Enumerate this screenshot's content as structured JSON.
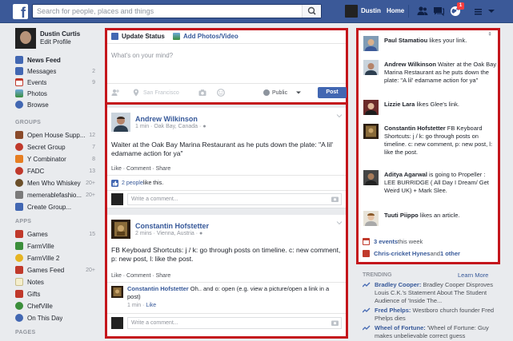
{
  "topbar": {
    "logo": "f",
    "search_placeholder": "Search for people, places and things",
    "user_name": "Dustin",
    "home_label": "Home",
    "notification_count": "1"
  },
  "leftnav": {
    "profile_name": "Dustin Curtis",
    "edit_profile": "Edit Profile",
    "favorites": [
      {
        "label": "News Feed",
        "icon": "news-feed-icon",
        "color": "#4267b2",
        "count": ""
      },
      {
        "label": "Messages",
        "icon": "messages-icon",
        "color": "#4267b2",
        "count": "2"
      },
      {
        "label": "Events",
        "icon": "events-icon",
        "color": "#c0392b",
        "count": "9"
      },
      {
        "label": "Photos",
        "icon": "photos-icon",
        "color": "#3b8e3b",
        "count": ""
      },
      {
        "label": "Browse",
        "icon": "browse-icon",
        "color": "#4267b2",
        "count": ""
      }
    ],
    "groups_heading": "GROUPS",
    "groups": [
      {
        "label": "Open House Supp...",
        "icon": "group-icon",
        "color": "#8a4a2a",
        "count": "12"
      },
      {
        "label": "Secret Group",
        "icon": "group-icon",
        "color": "#c0392b",
        "count": "7"
      },
      {
        "label": "Y Combinator",
        "icon": "group-icon",
        "color": "#e67e22",
        "count": "8"
      },
      {
        "label": "FADC",
        "icon": "group-icon",
        "color": "#c0392b",
        "count": "13"
      },
      {
        "label": "Men Who Whiskey",
        "icon": "group-icon",
        "color": "#6b4f2a",
        "count": "20+"
      },
      {
        "label": "memerablefashio...",
        "icon": "group-icon",
        "color": "#7a7a7a",
        "count": "20+"
      },
      {
        "label": "Create Group...",
        "icon": "create-group-icon",
        "color": "#4267b2",
        "count": ""
      }
    ],
    "apps_heading": "APPS",
    "apps": [
      {
        "label": "Games",
        "icon": "games-icon",
        "color": "#c0392b",
        "count": "15"
      },
      {
        "label": "FarmVille",
        "icon": "farmville-icon",
        "color": "#3b8e3b",
        "count": ""
      },
      {
        "label": "FarmVille 2",
        "icon": "farmville2-icon",
        "color": "#e6b422",
        "count": ""
      },
      {
        "label": "Games Feed",
        "icon": "games-feed-icon",
        "color": "#c0392b",
        "count": "20+"
      },
      {
        "label": "Notes",
        "icon": "notes-icon",
        "color": "#e0d7b0",
        "count": ""
      },
      {
        "label": "Gifts",
        "icon": "gifts-icon",
        "color": "#c0392b",
        "count": ""
      },
      {
        "label": "ChefVille",
        "icon": "chefville-icon",
        "color": "#3b8e3b",
        "count": ""
      },
      {
        "label": "On This Day",
        "icon": "on-this-day-icon",
        "color": "#4267b2",
        "count": ""
      }
    ],
    "pages_heading": "PAGES"
  },
  "composer": {
    "update_status": "Update Status",
    "add_photos": "Add Photos/Video",
    "placeholder": "What's on your mind?",
    "location": "San Francisco",
    "audience": "Public",
    "post_label": "Post"
  },
  "stories": [
    {
      "author": "Andrew Wilkinson",
      "meta": "1 min · Oak Bay, Canada ·",
      "text": "Waiter at the Oak Bay Marina Restaurant as he puts down the plate: \"A lil' edamame action for ya\"",
      "actions": "Like · Comment · Share",
      "likes_link": "2 people",
      "likes_suffix": " like this.",
      "comment_placeholder": "Write a comment..."
    },
    {
      "author": "Constantin Hofstetter",
      "meta": "2 mins · Vienna, Austria ·",
      "text": "FB Keyboard Shortcuts: j / k: go through posts on timeline. c: new comment, p: new post, l: like the post.",
      "actions": "Like · Comment · Share",
      "comment_author": "Constantin Hofstetter",
      "comment_text": " Oh.. and o: open (e.g. view a picture/open a link in a post)",
      "comment_meta": "1 min · ",
      "comment_like": "Like",
      "comment_placeholder": "Write a comment..."
    }
  ],
  "ticker": {
    "toggle": "⇞",
    "items": [
      {
        "name": "Paul Stamatiou",
        "text": " likes your link."
      },
      {
        "name": "Andrew Wilkinson",
        "text": " Waiter at the Oak Bay Marina Restaurant as he puts down the plate: \"A lil' edamame action for ya\""
      },
      {
        "name": "Lizzie Lara",
        "text": " likes Glee's link."
      },
      {
        "name": "Constantin Hofstetter",
        "text": " FB Keyboard Shortcuts: j / k: go through posts on timeline. c: new comment, p: new post, l: like the post."
      },
      {
        "name": "Aditya Agarwal",
        "text": " is going to Propeller : LEE BURRIDGE ( All Day I Dream/ Get Weird UK) + Mark Slee."
      },
      {
        "name": "Tuuti Piippo",
        "text": " likes an article."
      }
    ]
  },
  "right": {
    "events_link": "3 events",
    "events_suffix": " this week",
    "birthday_name": "Chris-cricket Hynes",
    "birthday_suffix": " and ",
    "birthday_other": "1 other",
    "trending_heading": "TRENDING",
    "learn_more": "Learn More",
    "trends": [
      {
        "topic": "Bradley Cooper:",
        "text": " Bradley Cooper Disproves Louis C.K.'s Statement About The Student Audience of 'Inside The..."
      },
      {
        "topic": "Fred Phelps:",
        "text": " Westboro church founder Fred Phelps dies"
      },
      {
        "topic": "Wheel of Fortune:",
        "text": " 'Wheel of Fortune: Guy makes unbelievable correct guess"
      }
    ]
  }
}
